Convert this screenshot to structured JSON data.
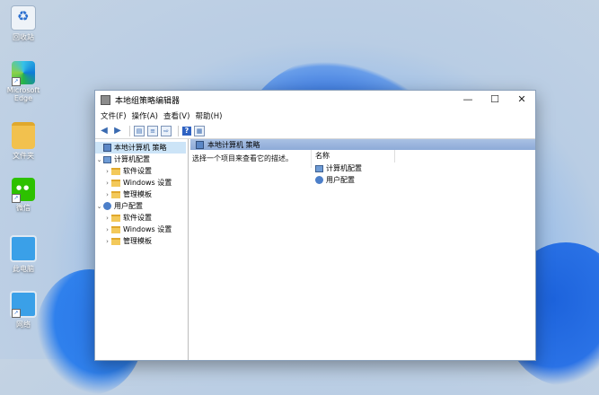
{
  "desktop": {
    "icons": [
      {
        "label": "回收站",
        "icon": "recycle-bin-icon"
      },
      {
        "label": "Microsoft Edge",
        "icon": "edge-icon"
      },
      {
        "label": "文件夹",
        "icon": "folder-icon"
      },
      {
        "label": "微信",
        "icon": "wechat-icon"
      },
      {
        "label": "此电脑",
        "icon": "computer-icon"
      },
      {
        "label": "网络",
        "icon": "network-icon"
      }
    ]
  },
  "window": {
    "title": "本地组策略编辑器",
    "controls": {
      "minimize": "—",
      "maximize": "☐",
      "close": "✕"
    },
    "menu": [
      "文件(F)",
      "操作(A)",
      "查看(V)",
      "帮助(H)"
    ],
    "toolbar": [
      "back-icon",
      "forward-icon",
      "show-tree-icon",
      "properties-icon",
      "export-icon",
      "help-icon",
      "view-icon"
    ]
  },
  "tree": {
    "root": "本地计算机 策略",
    "computer_config": "计算机配置",
    "user_config": "用户配置",
    "software": "软件设置",
    "windows": "Windows 设置",
    "admin": "管理模板"
  },
  "pane": {
    "header": "本地计算机 策略",
    "description": "选择一个项目来查看它的描述。",
    "column_name": "名称",
    "items": [
      "计算机配置",
      "用户配置"
    ]
  }
}
